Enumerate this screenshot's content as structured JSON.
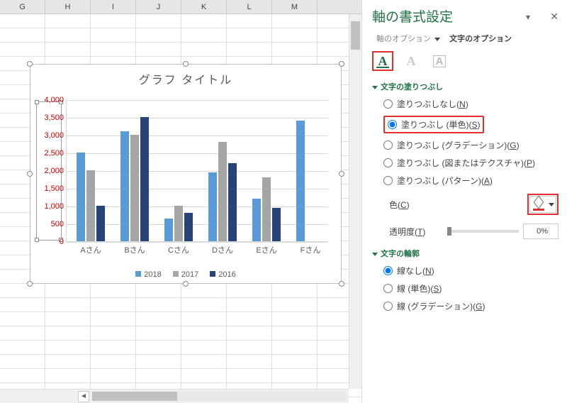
{
  "columns": [
    "G",
    "H",
    "I",
    "J",
    "K",
    "L",
    "M"
  ],
  "pane": {
    "title": "軸の書式設定",
    "tab_axis_options": "軸のオプション",
    "tab_text_options": "文字のオプション",
    "section_fill": "文字の塗りつぶし",
    "fill_none": "塗りつぶしなし(",
    "fill_none_u": "N",
    "fill_none_end": ")",
    "fill_solid": "塗りつぶし (単色)(",
    "fill_solid_u": "S",
    "fill_solid_end": ")",
    "fill_grad": "塗りつぶし (グラデーション)(",
    "fill_grad_u": "G",
    "fill_grad_end": ")",
    "fill_tex": "塗りつぶし (図またはテクスチャ)(",
    "fill_tex_u": "P",
    "fill_tex_end": ")",
    "fill_pat": "塗りつぶし (パターン)(",
    "fill_pat_u": "A",
    "fill_pat_end": ")",
    "color_label": "色(",
    "color_u": "C",
    "color_end": ")",
    "trans_label": "透明度(",
    "trans_u": "T",
    "trans_end": ")",
    "trans_value": "0%",
    "section_outline": "文字の輪郭",
    "line_none": "線なし(",
    "line_none_u": "N",
    "line_none_end": ")",
    "line_solid": "線 (単色)(",
    "line_solid_u": "S",
    "line_solid_end": ")",
    "line_grad": "線 (グラデーション)(",
    "line_grad_u": "G",
    "line_grad_end": ")"
  },
  "chart_data": {
    "type": "bar",
    "title": "グラフ タイトル",
    "categories": [
      "Aさん",
      "Bさん",
      "Cさん",
      "Dさん",
      "Eさん",
      "Fさん"
    ],
    "series": [
      {
        "name": "2018",
        "values": [
          2500,
          3100,
          650,
          1950,
          1200,
          3400
        ],
        "color": "#5b9bd5"
      },
      {
        "name": "2017",
        "values": [
          2000,
          3000,
          1000,
          2800,
          1800,
          null
        ],
        "color": "#a5a5a5"
      },
      {
        "name": "2016",
        "values": [
          1000,
          3500,
          800,
          2200,
          950,
          null
        ],
        "color": "#264478"
      }
    ],
    "ylim": [
      0,
      4000
    ],
    "ystep": 500,
    "xlabel": "",
    "ylabel": ""
  }
}
